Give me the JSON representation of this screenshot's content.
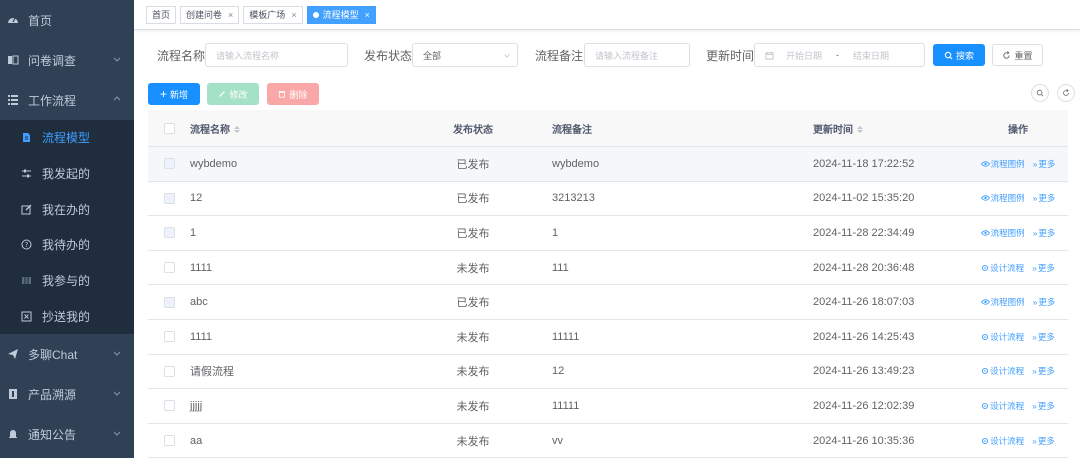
{
  "sidebar": {
    "items": [
      {
        "label": "首页",
        "icon": "dashboard-icon"
      },
      {
        "label": "问卷调查",
        "icon": "survey-icon"
      },
      {
        "label": "工作流程",
        "icon": "workflow-icon"
      }
    ],
    "sub_items": [
      {
        "label": "流程模型",
        "icon": "document-icon",
        "active": true
      },
      {
        "label": "我发起的",
        "icon": "sliders-icon"
      },
      {
        "label": "我在办的",
        "icon": "edit-icon"
      },
      {
        "label": "我待办的",
        "icon": "question-icon"
      },
      {
        "label": "我参与的",
        "icon": "grid-icon"
      },
      {
        "label": "抄送我的",
        "icon": "copy-icon"
      }
    ],
    "bottom_items": [
      {
        "label": "多聊Chat",
        "icon": "send-icon"
      },
      {
        "label": "产品溯源",
        "icon": "product-icon"
      },
      {
        "label": "通知公告",
        "icon": "bell-icon"
      }
    ]
  },
  "tags": [
    {
      "label": "首页"
    },
    {
      "label": "创建问卷"
    },
    {
      "label": "模板广场"
    },
    {
      "label": "流程模型",
      "active": true
    }
  ],
  "search": {
    "name_label": "流程名称",
    "name_placeholder": "请输入流程名称",
    "status_label": "发布状态",
    "status_value": "全部",
    "remark_label": "流程备注",
    "remark_placeholder": "请输入流程备注",
    "time_label": "更新时间",
    "start_placeholder": "开始日期",
    "range_sep": "-",
    "end_placeholder": "结束日期",
    "search_btn": "搜索",
    "reset_btn": "重置"
  },
  "toolbar": {
    "add": "新增",
    "edit": "修改",
    "delete": "删除"
  },
  "table": {
    "headers": {
      "name": "流程名称",
      "status": "发布状态",
      "remark": "流程备注",
      "time": "更新时间",
      "op": "操作"
    },
    "rows": [
      {
        "name": "wybdemo",
        "status": "已发布",
        "remark": "wybdemo",
        "time": "2024-11-18 17:22:52",
        "op1": "流程图例",
        "op2": "更多",
        "disabled": true,
        "hover": true
      },
      {
        "name": "12",
        "status": "已发布",
        "remark": "3213213",
        "time": "2024-11-02 15:35:20",
        "op1": "流程图例",
        "op2": "更多",
        "disabled": true
      },
      {
        "name": "1",
        "status": "已发布",
        "remark": "1",
        "time": "2024-11-28 22:34:49",
        "op1": "流程图例",
        "op2": "更多",
        "disabled": true
      },
      {
        "name": "1111",
        "status": "未发布",
        "remark": "111",
        "time": "2024-11-28 20:36:48",
        "op1": "设计流程",
        "op2": "更多"
      },
      {
        "name": "abc",
        "status": "已发布",
        "remark": "",
        "time": "2024-11-26 18:07:03",
        "op1": "流程图例",
        "op2": "更多",
        "disabled": true
      },
      {
        "name": "1111",
        "status": "未发布",
        "remark": "11111",
        "time": "2024-11-26 14:25:43",
        "op1": "设计流程",
        "op2": "更多"
      },
      {
        "name": "请假流程",
        "status": "未发布",
        "remark": "12",
        "time": "2024-11-26 13:49:23",
        "op1": "设计流程",
        "op2": "更多"
      },
      {
        "name": "jjjjj",
        "status": "未发布",
        "remark": "11111",
        "time": "2024-11-26 12:02:39",
        "op1": "设计流程",
        "op2": "更多"
      },
      {
        "name": "aa",
        "status": "未发布",
        "remark": "vv",
        "time": "2024-11-26 10:35:36",
        "op1": "设计流程",
        "op2": "更多"
      }
    ]
  }
}
